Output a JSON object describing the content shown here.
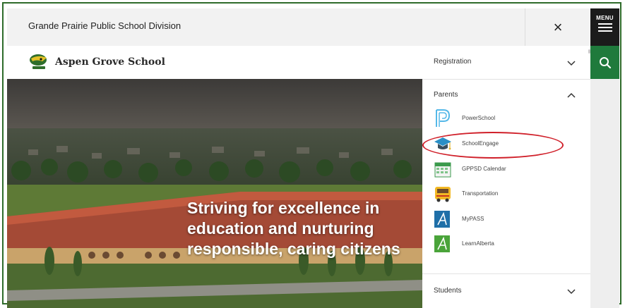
{
  "division": {
    "title": "Grande Prairie Public School Division",
    "close_label": "×"
  },
  "side": {
    "menu_label": "MENU"
  },
  "school": {
    "name": "Aspen Grove School"
  },
  "hero": {
    "lines": [
      "Striving for excellence in",
      "education and nurturing",
      "responsible, caring citizens"
    ]
  },
  "menu": {
    "registration": {
      "label": "Registration"
    },
    "parents": {
      "label": "Parents",
      "links": [
        {
          "label": "PowerSchool",
          "icon": "powerschool-icon"
        },
        {
          "label": "SchoolEngage",
          "icon": "graduation-cap-icon"
        },
        {
          "label": "GPPSD Calendar",
          "icon": "calendar-icon"
        },
        {
          "label": "Transportation",
          "icon": "school-bus-icon"
        },
        {
          "label": "MyPASS",
          "icon": "mypass-icon"
        },
        {
          "label": "LearnAlberta",
          "icon": "learnalberta-icon"
        }
      ]
    },
    "students": {
      "label": "Students"
    }
  },
  "colors": {
    "frame": "#2e6b2a",
    "search_bg": "#1f7a3c",
    "highlight": "#d0202a",
    "menu_bg": "#1b1b1b"
  }
}
